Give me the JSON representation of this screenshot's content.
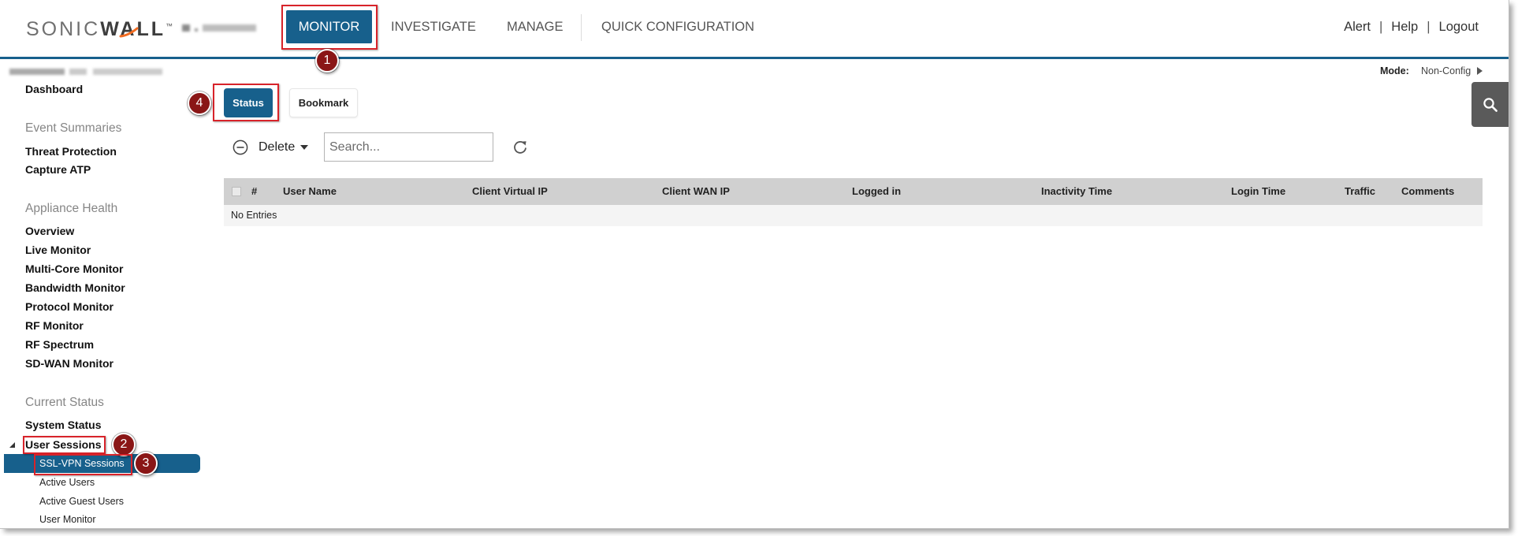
{
  "colors": {
    "brand_blue": "#17608c",
    "annotation_red": "#d8232a",
    "badge_red": "#8a1616",
    "logo_orange": "#f36c21",
    "table_header_bg": "#d0d0d0",
    "nav_text": "#555555"
  },
  "header": {
    "brand": {
      "light": "SONIC",
      "bold": "WALL",
      "tm": "™"
    },
    "nav": [
      {
        "label": "MONITOR",
        "active": true
      },
      {
        "label": "INVESTIGATE",
        "active": false
      },
      {
        "label": "MANAGE",
        "active": false
      },
      {
        "label": "QUICK CONFIGURATION",
        "active": false
      }
    ],
    "links": [
      {
        "label": "Alert"
      },
      {
        "label": "Help"
      },
      {
        "label": "Logout"
      }
    ],
    "link_separator": "|"
  },
  "mode": {
    "label": "Mode:",
    "value": "Non-Config",
    "icon": "triangle-right-icon"
  },
  "sidebar": {
    "dashboard": "Dashboard",
    "groups": [
      {
        "heading": "Event Summaries",
        "items": [
          "Threat Protection",
          "Capture ATP"
        ]
      },
      {
        "heading": "Appliance Health",
        "items": [
          "Overview",
          "Live Monitor",
          "Multi-Core Monitor",
          "Bandwidth Monitor",
          "Protocol Monitor",
          "RF Monitor",
          "RF Spectrum",
          "SD-WAN Monitor"
        ]
      },
      {
        "heading": "Current Status",
        "items": [
          "System Status"
        ],
        "expandable": {
          "label": "User Sessions",
          "expanded": true,
          "children": [
            {
              "label": "SSL-VPN Sessions",
              "selected": true
            },
            {
              "label": "Active Users",
              "selected": false
            },
            {
              "label": "Active Guest Users",
              "selected": false
            },
            {
              "label": "User Monitor",
              "selected": false
            }
          ]
        }
      }
    ]
  },
  "tabs": [
    {
      "label": "Status",
      "active": true
    },
    {
      "label": "Bookmark",
      "active": false
    }
  ],
  "toolbar": {
    "delete_label": "Delete",
    "search_placeholder": "Search...",
    "search_value": "",
    "icons": {
      "delete": "minus-circle-icon",
      "delete_menu": "caret-down-icon",
      "refresh": "refresh-icon",
      "global_search": "search-icon"
    }
  },
  "table": {
    "columns": [
      "#",
      "User Name",
      "Client Virtual IP",
      "Client WAN IP",
      "Logged in",
      "Inactivity Time",
      "Login Time",
      "Traffic",
      "Comments"
    ],
    "rows": [],
    "empty_text": "No Entries"
  },
  "annotations": [
    "1",
    "2",
    "3",
    "4"
  ]
}
